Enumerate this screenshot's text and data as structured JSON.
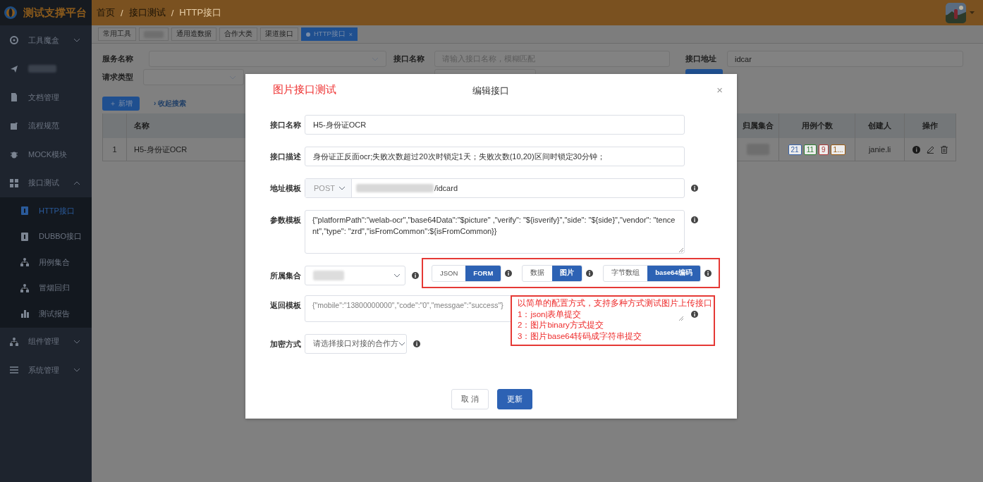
{
  "app": {
    "logo_text": "测试支撑平台"
  },
  "breadcrumb": [
    {
      "label": "首页",
      "current": false
    },
    {
      "separator": "/",
      "label": "接口测试",
      "current": false
    },
    {
      "separator": "/",
      "label": "HTTP接口",
      "current": true
    }
  ],
  "sidebar": {
    "items": [
      {
        "kind": "text",
        "label": "工具魔盒",
        "expanded": false
      },
      {
        "kind": "redacted"
      },
      {
        "kind": "text",
        "label": "文档管理"
      },
      {
        "kind": "text",
        "label": "流程规范"
      },
      {
        "kind": "text",
        "label": "MOCK模块"
      },
      {
        "kind": "text",
        "label": "接口测试",
        "expanded": true,
        "children": [
          {
            "label": "HTTP接口",
            "selected": true
          },
          {
            "label": "DUBBO接口",
            "selected": false
          },
          {
            "label": "用例集合",
            "selected": false
          },
          {
            "label": "冒烟回归",
            "selected": false
          },
          {
            "label": "测试报告",
            "selected": false
          }
        ]
      },
      {
        "kind": "text",
        "label": "组件管理",
        "expanded": false
      },
      {
        "kind": "text",
        "label": "系统管理",
        "expanded": false
      }
    ]
  },
  "tabs": [
    {
      "kind": "text",
      "label": "常用工具",
      "selected": false
    },
    {
      "kind": "redacted",
      "selected": false
    },
    {
      "kind": "text",
      "label": "通用造数据",
      "selected": false
    },
    {
      "kind": "text",
      "label": "合作大类",
      "selected": false
    },
    {
      "kind": "text",
      "label": "渠道接口",
      "selected": false
    },
    {
      "kind": "text",
      "label": "HTTP接口",
      "selected": true,
      "close": "×"
    }
  ],
  "search": {
    "service_label": "服务名称",
    "name_label": "接口名称",
    "name_placeholder": "请输入接口名称，模糊匹配",
    "address_label": "接口地址",
    "address_value": "idcar",
    "type_label": "请求类型"
  },
  "toolbar": {
    "add_button": "＋ 新增",
    "collapse_link": "› 收起搜索"
  },
  "table": {
    "columns": [
      "名称",
      "归属集合",
      "用例个数",
      "创建人",
      "操作"
    ],
    "rows": [
      {
        "index": "1",
        "name": "H5-身份证OCR",
        "counts": [
          {
            "text": "21",
            "color": "#3a64a8"
          },
          {
            "text": "11",
            "color": "#2e7d32"
          },
          {
            "text": "9",
            "color": "#b03a3a"
          },
          {
            "text": "1...",
            "color": "#9a5a12"
          }
        ],
        "creator": "janie.li"
      }
    ]
  },
  "modal": {
    "note_title": "图片接口测试",
    "title": "编辑接口",
    "close": "×",
    "fields": [
      {
        "kind": "input",
        "label": "接口名称",
        "value": "H5-身份证OCR"
      },
      {
        "kind": "input",
        "label": "接口描述",
        "value": "身份证正反面ocr;失败次数超过20次时锁定1天；失败次数(10,20)区间时锁定30分钟；"
      },
      {
        "kind": "url",
        "label": "地址模板",
        "method": "POST",
        "value": "/idcard",
        "info": true
      },
      {
        "kind": "textarea",
        "label": "参数模板",
        "value": "{\"platformPath\":\"welab-ocr\",\"base64Data\":\"$picture\" ,\"verify\": \"${isverify}\",\"side\": \"${side}\",\"vendor\": \"tencent\",\"type\": \"zrd\",\"isFromCommon\":${isFromCommon}}",
        "info": true
      },
      {
        "kind": "collection",
        "label": "所属集合",
        "info": true,
        "groups": [
          {
            "options": [
              {
                "label": "JSON",
                "selected": false
              },
              {
                "label": "FORM",
                "selected": true
              }
            ]
          },
          {
            "options": [
              {
                "label": "数据",
                "selected": false
              },
              {
                "label": "图片",
                "selected": true
              }
            ]
          },
          {
            "options": [
              {
                "label": "字节数组",
                "selected": false
              },
              {
                "label": "base64编码",
                "selected": true
              }
            ]
          }
        ]
      },
      {
        "kind": "textarea",
        "label": "返回模板",
        "placeholder": "{\"mobile\":\"13800000000\",\"code\":\"0\",\"messgae\":\"success\"}",
        "info": true
      },
      {
        "kind": "select",
        "label": "加密方式",
        "placeholder": "请选择接口对接的合作方",
        "info": true
      }
    ],
    "note": [
      "以简单的配置方式，支持多种方式测试图片上传接口",
      "1：json|表单提交",
      "2：图片binary方式提交",
      "3：图片base64转码成字符串提交"
    ],
    "buttons": [
      {
        "label": "取 消",
        "kind": "secondary"
      },
      {
        "label": "更新",
        "kind": "primary"
      }
    ]
  }
}
